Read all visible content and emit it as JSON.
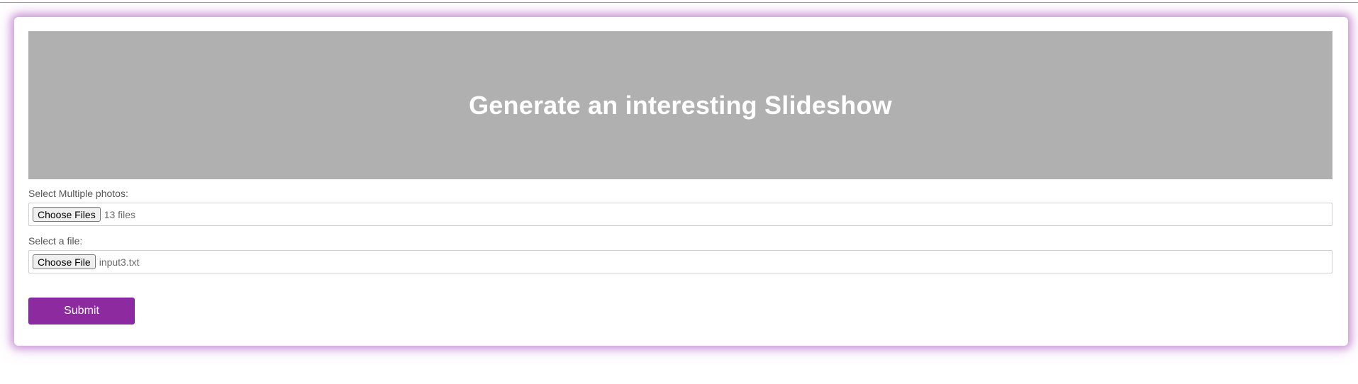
{
  "hero": {
    "title": "Generate an interesting Slideshow",
    "background": "#b0b0b0"
  },
  "form": {
    "photos": {
      "label": "Select Multiple photos:",
      "button_label": "Choose Files",
      "status": "13 files"
    },
    "file": {
      "label": "Select a file:",
      "button_label": "Choose File",
      "status": "input3.txt"
    },
    "submit_label": "Submit",
    "accent_color": "#8e2aa0"
  }
}
